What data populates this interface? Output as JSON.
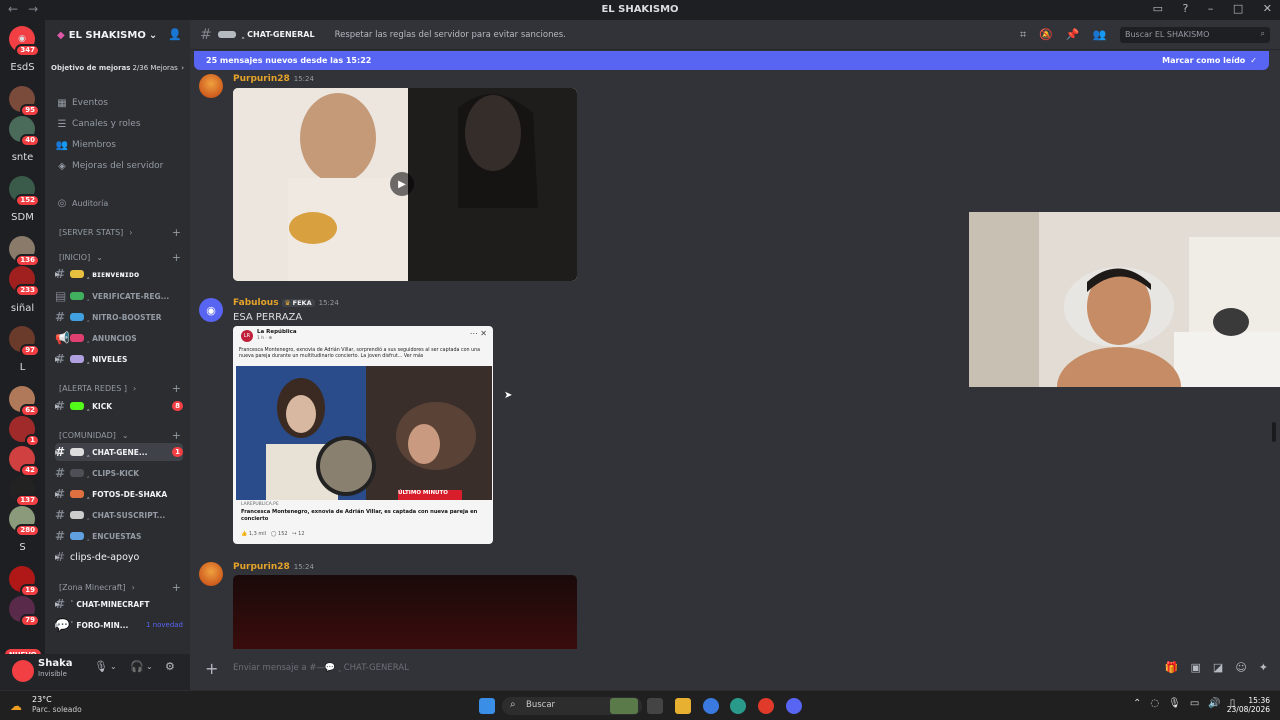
{
  "window": {
    "title": "EL SHAKISMO"
  },
  "guilds": {
    "home_badge": "347",
    "items": [
      {
        "label": "EsdS"
      },
      {
        "badge": "95"
      },
      {
        "badge": "40"
      },
      {
        "label": "snte"
      },
      {
        "badge": "152"
      },
      {
        "label": "SDM"
      },
      {
        "badge": "136"
      },
      {
        "badge": "233"
      },
      {
        "label": "siñal"
      },
      {
        "badge": "97"
      },
      {
        "label": "L"
      },
      {
        "badge": "62"
      },
      {
        "badge": "1"
      },
      {
        "badge": "42"
      },
      {
        "badge": "137"
      },
      {
        "badge": "280"
      },
      {
        "label": "S"
      },
      {
        "badge": "19"
      },
      {
        "badge": "79"
      }
    ],
    "nuevo": "NUEVO"
  },
  "server": {
    "name": "EL SHAKISMO",
    "boost_label": "Objetivo de mejoras",
    "boost_progress": "2/36 Mejoras",
    "menu": [
      "Eventos",
      "Canales y roles",
      "Miembros",
      "Mejoras del servidor"
    ],
    "audit": "Auditoría",
    "categories": {
      "server_stats": "[SERVER STATS]",
      "inicio": "[INICIO]",
      "alerta": "[ALERTA REDES ]",
      "comunidad": "[COMUNIDAD]",
      "minecraft": "[Zona Minecraft]"
    },
    "channels": {
      "bienvenido": "ꞈ ʙɪᴇɴᴠᴇɴɪᴅᴏ",
      "verificate": "ꞈ VERIFICATE-REG...",
      "nitro": "ꞈ NITRO-BOOSTER",
      "anuncios": "ꞈ ANUNCIOS",
      "niveles": "ꞈ NIVELES",
      "kick": "ꞈ KICK",
      "kick_count": "8",
      "chat_general": "ꞈ CHAT-GENE...",
      "chat_general_count": "1",
      "clips_kick": "ꞈ CLIPS-KICK",
      "fotos": "ꞈ FOTOS-DE-SHAKA",
      "chat_suscript": "ꞈ CHAT-SUSCRIPT...",
      "encuestas": "ꞈ ENCUESTAS",
      "clips_apoyo": "clips-de-apoyo",
      "chat_minecraft": "˙ CHAT-MINECRAFT",
      "foro_min": "˙ FORO-MIN...",
      "foro_novedad": "1 novedad"
    }
  },
  "user": {
    "name": "Shaka",
    "status": "Invisible"
  },
  "channel_header": {
    "name": "ꞈ CHAT-GENERAL",
    "topic": "Respetar las reglas del servidor para evitar sanciones.",
    "search_placeholder": "Buscar EL SHAKISMO"
  },
  "new_messages_bar": {
    "text": "25 mensajes nuevos desde las 15:22",
    "mark_read": "Marcar como leído"
  },
  "messages": [
    {
      "author": "Purpurin28",
      "time": "15:24",
      "author_color": "#e5a32a"
    },
    {
      "author": "Fabulous",
      "tag": "FEKA",
      "time": "15:24",
      "text": "ESA PERRAZA",
      "author_color": "#e5a32a",
      "embed": {
        "source": "La República",
        "source_sub": "1 h · ⊕",
        "post_text": "Francesca Montenegro, exnovia de Adrián Villar, sorprendió a sus seguidores al ser captada con una nueva pareja durante un multitudinario concierto. La joven disfrut... Ver más",
        "banner": "ÚLTIMO MINUTO",
        "link_domain": "LAREPUBLICA.PE",
        "link_title": "Francesca Montenegro, exnovia de Adrián Villar, es captada con nueva pareja en concierto",
        "likes": "1,3 mil",
        "comments": "152",
        "shares": "12"
      }
    },
    {
      "author": "Purpurin28",
      "time": "15:24",
      "author_color": "#e5a32a"
    }
  ],
  "composer": {
    "placeholder": "Enviar mensaje a #—💬 ꞈ CHAT-GENERAL"
  },
  "taskbar": {
    "weather_temp": "23°C",
    "weather_cond": "Parc. soleado",
    "search": "Buscar",
    "time": "15:36",
    "date": "23/08/2026"
  }
}
